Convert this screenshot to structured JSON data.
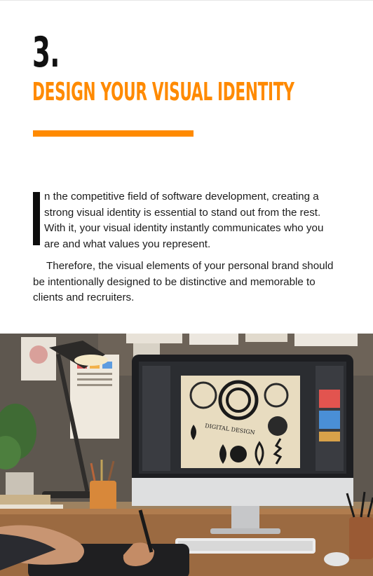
{
  "chapter": {
    "number": "3.",
    "title": "DESIGN YOUR VISUAL IDENTITY"
  },
  "body": {
    "paragraph1_dropcap": "I",
    "paragraph1_rest": "n the competitive field of software development, creating a strong visual identity is essential to stand out from the rest. With it, your visual identity instantly communicates who you are and what values you represent.",
    "paragraph2": "Therefore, the visual elements of your personal brand should be intentionally designed to be distinctive and memorable to clients and recruiters."
  },
  "hero_image": {
    "screen_text": "DIGITAL DESIGN"
  },
  "colors": {
    "accent": "#ff8a00",
    "heading": "#111111",
    "text": "#1c1c1c"
  }
}
